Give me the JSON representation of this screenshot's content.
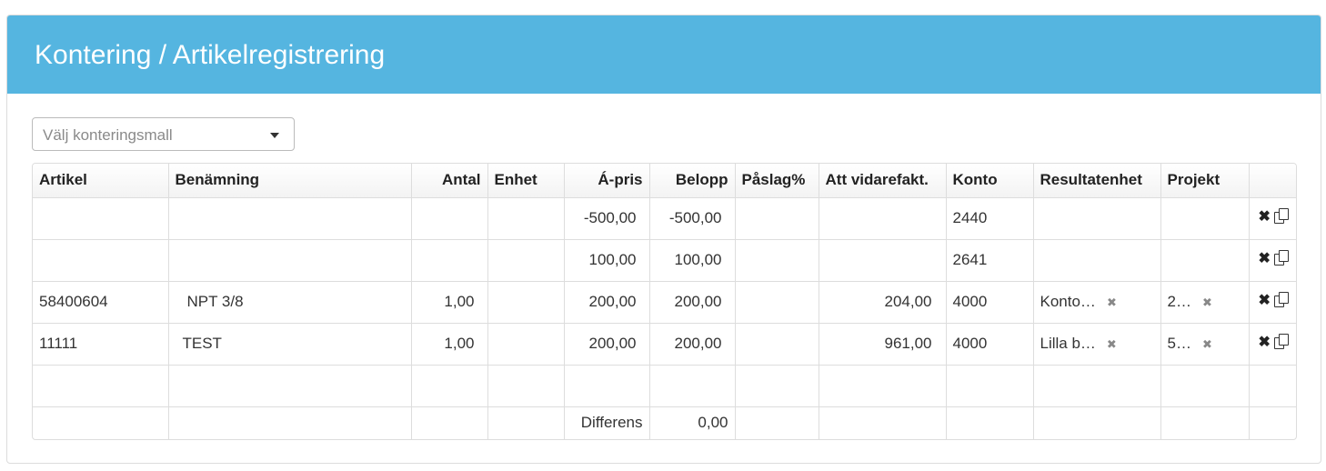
{
  "header": {
    "title": "Kontering / Artikelregistrering"
  },
  "template_select": {
    "placeholder": "Välj konteringsmall"
  },
  "table": {
    "columns": [
      "Artikel",
      "Benämning",
      "Antal",
      "Enhet",
      "Á-pris",
      "Belopp",
      "Påslag%",
      "Att vidarefakt.",
      "Konto",
      "Resultatenhet",
      "Projekt"
    ],
    "rows": [
      {
        "artikel": "",
        "benamning": "",
        "antal": "",
        "enhet": "",
        "apris": "-500,00",
        "belopp": "-500,00",
        "paslag": "",
        "vidarefakt": "",
        "konto": "2440",
        "resultatenhet": "",
        "projekt": ""
      },
      {
        "artikel": "",
        "benamning": "",
        "antal": "",
        "enhet": "",
        "apris": "100,00",
        "belopp": "100,00",
        "paslag": "",
        "vidarefakt": "",
        "konto": "2641",
        "resultatenhet": "",
        "projekt": ""
      },
      {
        "artikel": "58400604",
        "benamning": "NPT 3/8",
        "antal": "1,00",
        "enhet": "",
        "apris": "200,00",
        "belopp": "200,00",
        "paslag": "",
        "vidarefakt": "204,00",
        "konto": "4000",
        "resultatenhet": "Konto…",
        "projekt": "2…"
      },
      {
        "artikel": "11111",
        "benamning": "TEST",
        "antal": "1,00",
        "enhet": "",
        "apris": "200,00",
        "belopp": "200,00",
        "paslag": "",
        "vidarefakt": "961,00",
        "konto": "4000",
        "resultatenhet": "Lilla b…",
        "projekt": "5…"
      }
    ],
    "footer": {
      "label": "Differens",
      "value": "0,00"
    },
    "actions": {
      "delete_icon": "times-icon",
      "copy_icon": "copy-icon"
    }
  }
}
